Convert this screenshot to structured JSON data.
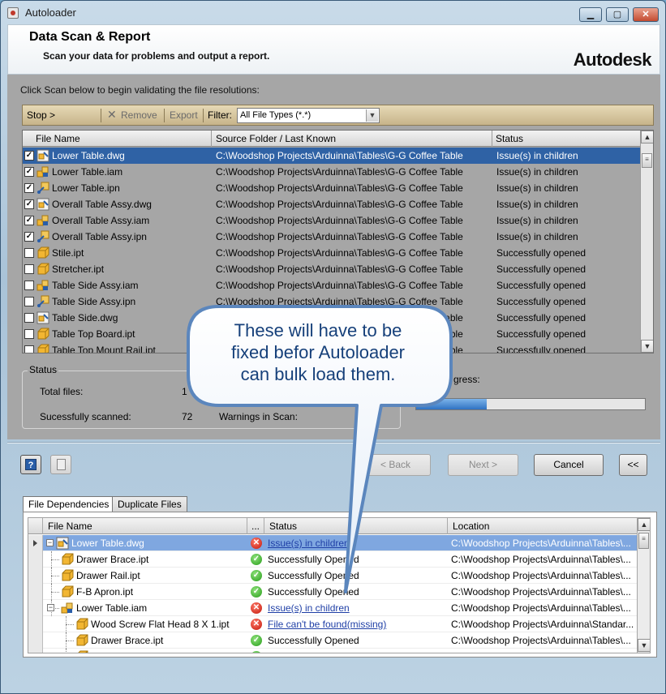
{
  "window": {
    "title": "Autoloader",
    "controls": {
      "minimize": "▁",
      "maximize": "▢",
      "close": "✕"
    }
  },
  "header": {
    "title": "Data Scan & Report",
    "subtitle": "Scan your data for problems and output a report.",
    "brand": "Autodesk"
  },
  "instruction": "Click Scan below to begin validating the file resolutions:",
  "toolbar": {
    "stop": "Stop >",
    "remove": "Remove",
    "export": "Export",
    "filter_label": "Filter:",
    "filter_value": "All File Types (*.*)"
  },
  "file_grid": {
    "columns": [
      "File Name",
      "Source Folder / Last Known",
      "Status"
    ],
    "rows": [
      {
        "checked": true,
        "icon": "dwg",
        "name": "Lower Table.dwg",
        "folder": "C:\\Woodshop Projects\\Arduinna\\Tables\\G-G Coffee Table",
        "status": "Issue(s) in children",
        "selected": true
      },
      {
        "checked": true,
        "icon": "iam",
        "name": "Lower Table.iam",
        "folder": "C:\\Woodshop Projects\\Arduinna\\Tables\\G-G Coffee Table",
        "status": "Issue(s) in children"
      },
      {
        "checked": true,
        "icon": "ipn",
        "name": "Lower Table.ipn",
        "folder": "C:\\Woodshop Projects\\Arduinna\\Tables\\G-G Coffee Table",
        "status": "Issue(s) in children"
      },
      {
        "checked": true,
        "icon": "dwg",
        "name": "Overall Table Assy.dwg",
        "folder": "C:\\Woodshop Projects\\Arduinna\\Tables\\G-G Coffee Table",
        "status": "Issue(s) in children"
      },
      {
        "checked": true,
        "icon": "iam",
        "name": "Overall Table Assy.iam",
        "folder": "C:\\Woodshop Projects\\Arduinna\\Tables\\G-G Coffee Table",
        "status": "Issue(s) in children"
      },
      {
        "checked": true,
        "icon": "ipn",
        "name": "Overall Table Assy.ipn",
        "folder": "C:\\Woodshop Projects\\Arduinna\\Tables\\G-G Coffee Table",
        "status": "Issue(s) in children"
      },
      {
        "checked": false,
        "icon": "ipt",
        "name": "Stile.ipt",
        "folder": "C:\\Woodshop Projects\\Arduinna\\Tables\\G-G Coffee Table",
        "status": "Successfully opened"
      },
      {
        "checked": false,
        "icon": "ipt",
        "name": "Stretcher.ipt",
        "folder": "C:\\Woodshop Projects\\Arduinna\\Tables\\G-G Coffee Table",
        "status": "Successfully opened"
      },
      {
        "checked": false,
        "icon": "iam",
        "name": "Table Side Assy.iam",
        "folder": "C:\\Woodshop Projects\\Arduinna\\Tables\\G-G Coffee Table",
        "status": "Successfully opened"
      },
      {
        "checked": false,
        "icon": "ipn",
        "name": "Table Side Assy.ipn",
        "folder": "C:\\Woodshop Projects\\Arduinna\\Tables\\G-G Coffee Table",
        "status": "Successfully opened"
      },
      {
        "checked": false,
        "icon": "dwg",
        "name": "Table Side.dwg",
        "folder": "C:\\Woodshop Projects\\Arduinna\\Tables\\G-G Coffee Table",
        "status": "Successfully opened"
      },
      {
        "checked": false,
        "icon": "ipt",
        "name": "Table Top Board.ipt",
        "folder": "C:\\Woodshop Projects\\Arduinna\\Tables\\G-G Coffee Table",
        "status": "Successfully opened"
      },
      {
        "checked": false,
        "icon": "ipt",
        "name": "Table Top Mount Rail.ipt",
        "folder": "C:\\Woodshop Projects\\Arduinna\\Tables\\G-G Coffee Table",
        "status": "Successfully opened"
      }
    ]
  },
  "status_box": {
    "legend": "Status",
    "total_label": "Total files:",
    "total_value": "1",
    "scanned_label": "Sucessfully scanned:",
    "scanned_value": "72",
    "warnings_label": "Warnings in Scan:",
    "warnings_value": "0"
  },
  "progress": {
    "label": "gress:",
    "fraction": 0.31
  },
  "buttons": {
    "back": "< Back",
    "next": "Next >",
    "cancel": "Cancel",
    "collapse": "<<"
  },
  "tabs": [
    "File Dependencies",
    "Duplicate Files"
  ],
  "dep_grid": {
    "columns": [
      "File Name",
      "...",
      "Status",
      "Location"
    ],
    "rows": [
      {
        "level": 0,
        "expander": "−",
        "icon": "dwg",
        "name": "Lower Table.dwg",
        "state": "err",
        "status": "Issue(s) in children",
        "link": true,
        "location": "C:\\Woodshop Projects\\Arduinna\\Tables\\...",
        "selected": true
      },
      {
        "level": 1,
        "icon": "ipt",
        "name": "Drawer Brace.ipt",
        "state": "ok",
        "status": "Successfully Opened",
        "location": "C:\\Woodshop Projects\\Arduinna\\Tables\\..."
      },
      {
        "level": 1,
        "icon": "ipt",
        "name": "Drawer Rail.ipt",
        "state": "ok",
        "status": "Successfully Opened",
        "location": "C:\\Woodshop Projects\\Arduinna\\Tables\\..."
      },
      {
        "level": 1,
        "icon": "ipt",
        "name": "F-B Apron.ipt",
        "state": "ok",
        "status": "Successfully Opened",
        "location": "C:\\Woodshop Projects\\Arduinna\\Tables\\..."
      },
      {
        "level": 1,
        "expander": "−",
        "icon": "iam",
        "name": "Lower Table.iam",
        "state": "err",
        "status": "Issue(s) in children",
        "link": true,
        "location": "C:\\Woodshop Projects\\Arduinna\\Tables\\..."
      },
      {
        "level": 2,
        "icon": "ipt",
        "name": "Wood Screw Flat Head 8 X 1.ipt",
        "state": "err",
        "status": "File can't be found(missing)",
        "link": true,
        "location": "C:\\Woodshop Projects\\Arduinna\\Standar..."
      },
      {
        "level": 2,
        "icon": "ipt",
        "name": "Drawer Brace.ipt",
        "state": "ok",
        "status": "Successfully Opened",
        "location": "C:\\Woodshop Projects\\Arduinna\\Tables\\..."
      },
      {
        "level": 2,
        "icon": "ipt",
        "name": "Drawer Rail.ipt",
        "state": "ok",
        "status": "Successfully Opened",
        "location": "C:\\Woodshop Projects\\Arduinna\\Tables\\..."
      }
    ]
  },
  "callout": {
    "lines": [
      "These will have to be",
      "fixed befor Autoloader",
      "can bulk load them."
    ]
  },
  "colors": {
    "selection": "#2f62a5",
    "callout_fill": "#ffffff",
    "callout_stroke": "#5b86bd",
    "callout_text": "#16407a"
  }
}
